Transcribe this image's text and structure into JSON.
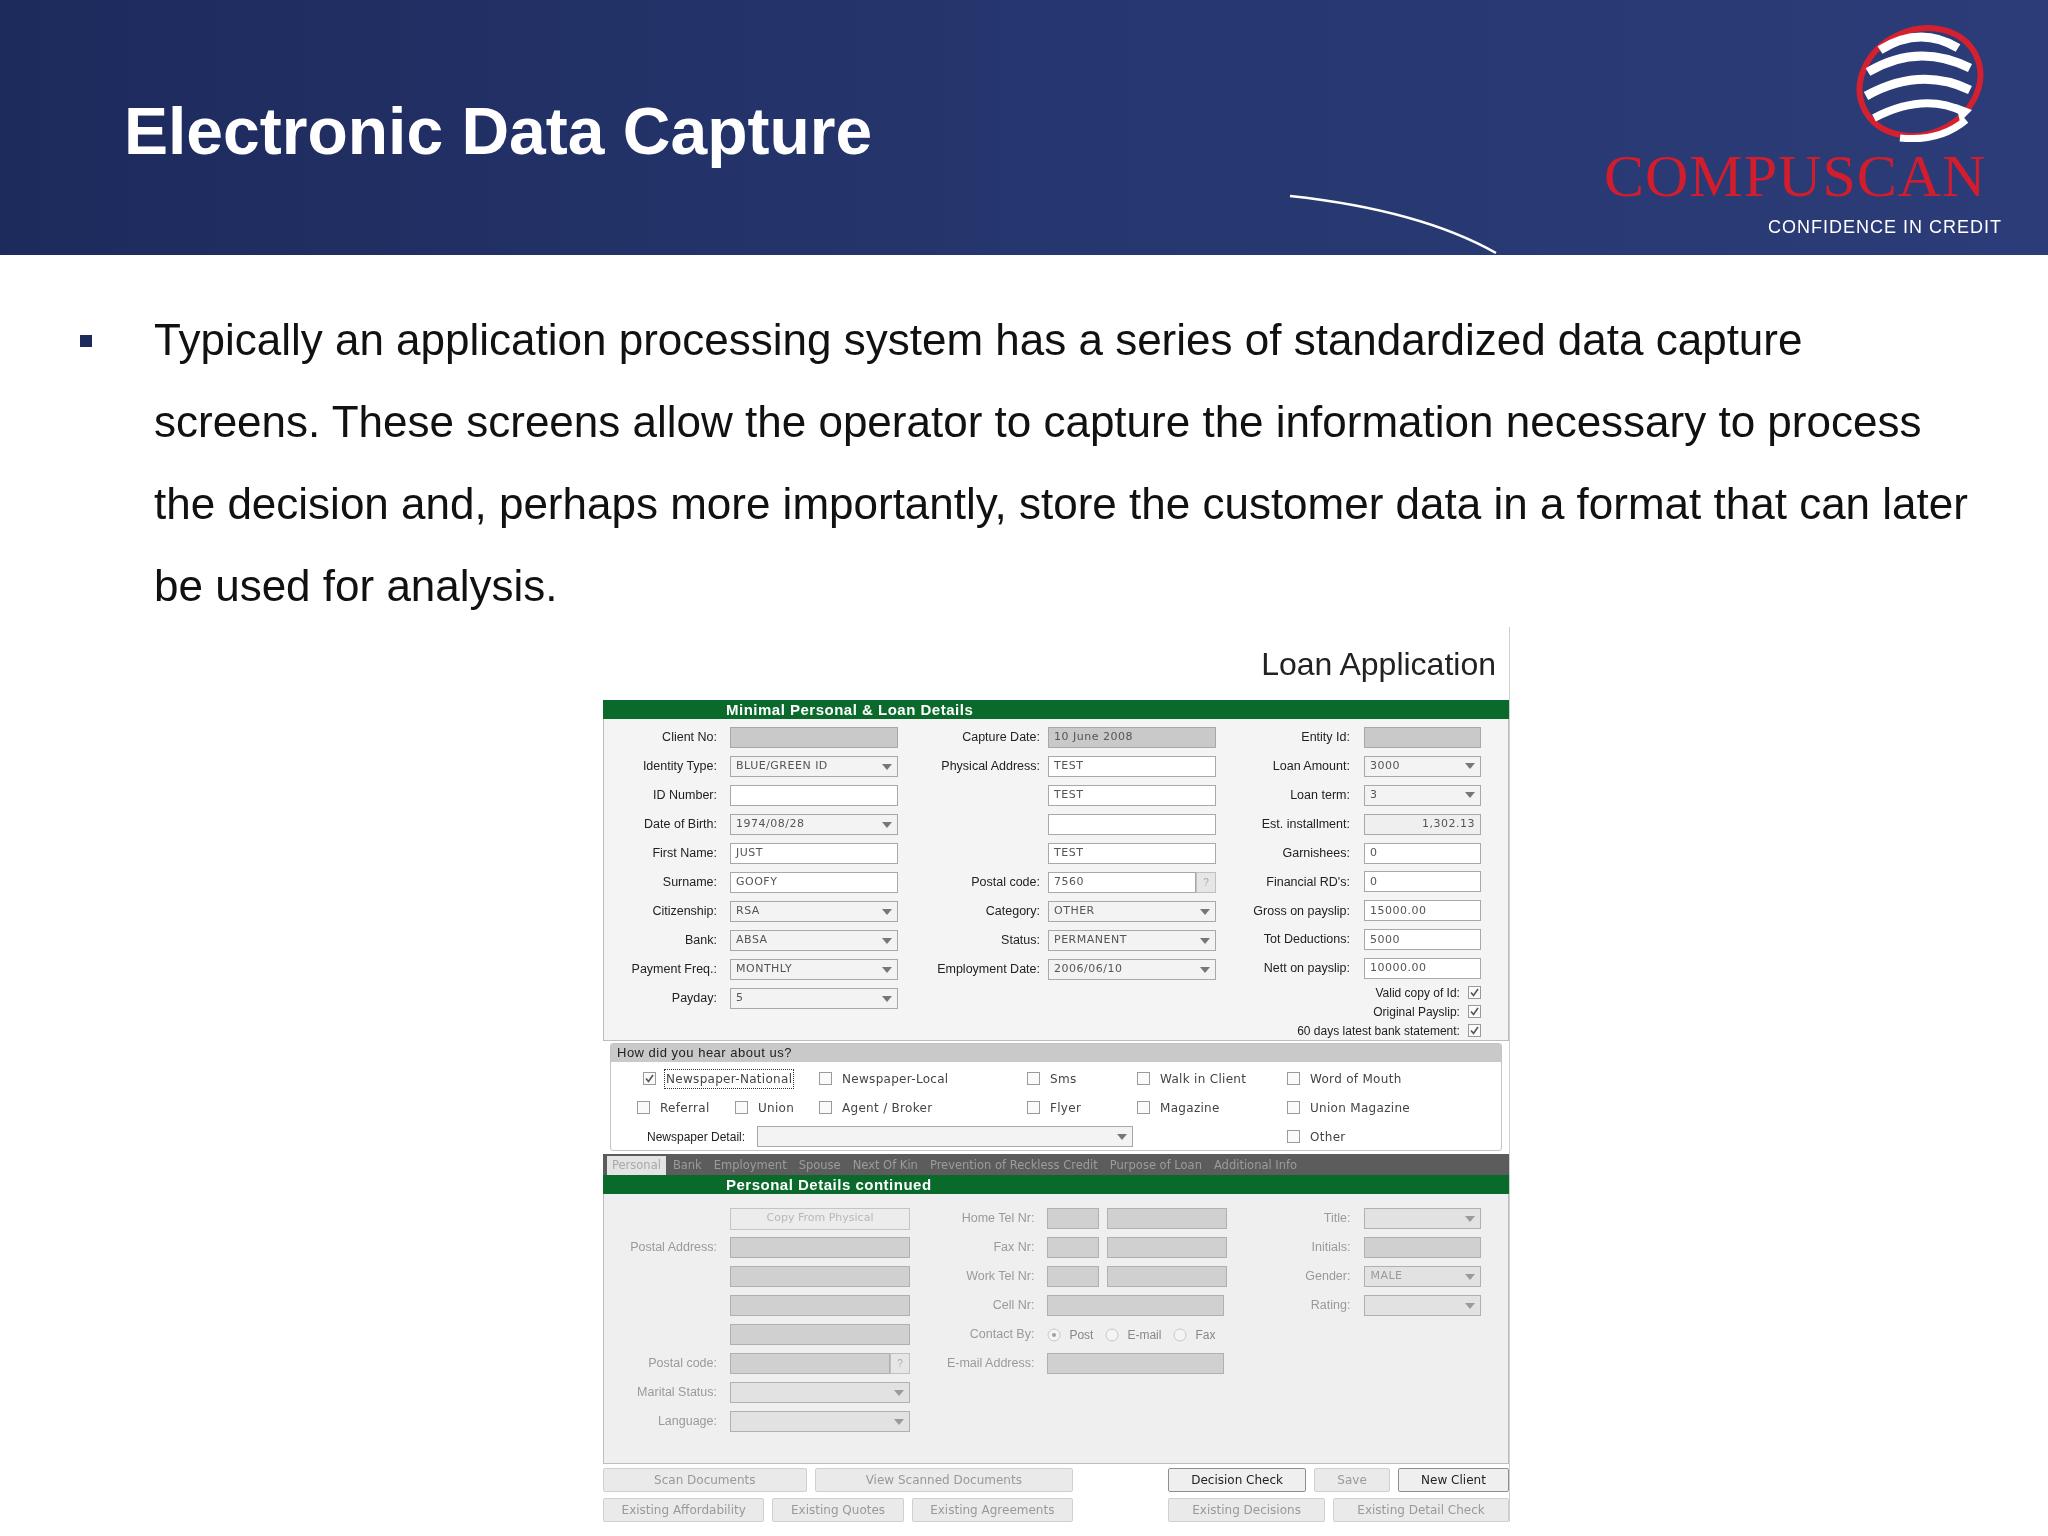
{
  "slide": {
    "title": "Electronic Data Capture",
    "logo": {
      "name": "COMPUSCAN",
      "tagline": "CONFIDENCE IN CREDIT"
    },
    "bullets": [
      "Typically an application processing system has a series of standardized data capture screens. These screens allow the operator to capture the information necessary to process the decision and, perhaps more importantly, store the customer data in a format that can later be used for analysis."
    ]
  },
  "form": {
    "title": "Loan Application",
    "main": {
      "heading": "Minimal Personal & Loan Details",
      "disabled": false,
      "columns": [
        [
          {
            "label": "Client No:",
            "kind": "readonly"
          },
          {
            "label": "Identity Type:",
            "kind": "select",
            "value": "BLUE/GREEN ID"
          },
          {
            "label": "ID Number:",
            "kind": "text"
          },
          {
            "label": "Date of Birth:",
            "kind": "select",
            "value": "1974/08/28"
          },
          {
            "label": "First Name:",
            "kind": "text",
            "value": "JUST"
          },
          {
            "label": "Surname:",
            "kind": "text",
            "value": "GOOFY"
          },
          {
            "label": "Citizenship:",
            "kind": "select",
            "value": "RSA"
          },
          {
            "label": "Bank:",
            "kind": "select",
            "value": "ABSA"
          },
          {
            "label": "Payment Freq.:",
            "kind": "select",
            "value": "MONTHLY"
          },
          {
            "label": "Payday:",
            "kind": "select",
            "value": "5"
          }
        ],
        [
          {
            "label": "Capture Date:",
            "kind": "readonly",
            "value": "10 June 2008"
          },
          {
            "label": "Physical Address:",
            "kind": "text",
            "value": "TEST"
          },
          {
            "kind": "text",
            "value": "TEST"
          },
          {
            "kind": "text"
          },
          {
            "kind": "text",
            "value": "TEST"
          },
          {
            "label": "Postal code:",
            "kind": "lookup",
            "value": "7560",
            "button": "?"
          },
          {
            "label": "Category:",
            "kind": "select",
            "value": "OTHER"
          },
          {
            "label": "Status:",
            "kind": "select",
            "value": "PERMANENT"
          },
          {
            "label": "Employment Date:",
            "kind": "select",
            "value": "2006/06/10"
          }
        ],
        [
          {
            "label": "Entity Id:",
            "kind": "readonly"
          },
          {
            "label": "Loan Amount:",
            "kind": "select",
            "value": "3000"
          },
          {
            "label": "Loan term:",
            "kind": "select",
            "value": "3"
          },
          {
            "label": "Est. installment:",
            "kind": "amount",
            "value": "1,302.13"
          },
          {
            "label": "Garnishees:",
            "kind": "text",
            "value": "0"
          },
          {
            "label": "Financial RD's:",
            "kind": "text",
            "value": "0"
          },
          {
            "label": "Gross on payslip:",
            "kind": "text",
            "value": "15000.00"
          },
          {
            "label": "Tot Deductions:",
            "kind": "text",
            "value": "5000"
          },
          {
            "label": "Nett on payslip:",
            "kind": "text",
            "value": "10000.00"
          }
        ]
      ],
      "checks": [
        {
          "label": "Valid copy of Id:",
          "checked": true
        },
        {
          "label": "Original Payslip:",
          "checked": true
        },
        {
          "label": "60 days latest bank statement:",
          "checked": true
        }
      ]
    },
    "hear": {
      "heading": "How did you hear about us?",
      "rows": [
        [
          {
            "label": "Newspaper-National",
            "checked": true,
            "focused": true
          },
          "",
          {
            "label": "Newspaper-Local",
            "checked": false,
            "focused": false
          },
          {
            "label": "Sms",
            "checked": false,
            "focused": false
          },
          {
            "label": "Walk in Client",
            "checked": false,
            "focused": false
          },
          {
            "label": "Word of Mouth",
            "checked": false,
            "focused": false
          }
        ],
        [
          {
            "label": "Referral",
            "checked": false,
            "focused": false
          },
          {
            "label": "Union",
            "checked": false,
            "focused": false
          },
          {
            "label": "Agent / Broker",
            "checked": false,
            "focused": false
          },
          {
            "label": "Flyer",
            "checked": false,
            "focused": false
          },
          {
            "label": "Magazine",
            "checked": false,
            "focused": false
          },
          {
            "label": "Union Magazine",
            "checked": false,
            "focused": false
          }
        ]
      ],
      "detail_label": "Newspaper Detail:",
      "other": {
        "label": "Other",
        "checked": false,
        "focused": false
      }
    },
    "tabs": [
      {
        "label": "Personal",
        "selected": true
      },
      {
        "label": "Bank",
        "selected": false
      },
      {
        "label": "Employment",
        "selected": false
      },
      {
        "label": "Spouse",
        "selected": false
      },
      {
        "label": "Next Of Kin",
        "selected": false
      },
      {
        "label": "Prevention of Reckless Credit",
        "selected": false
      },
      {
        "label": "Purpose of Loan",
        "selected": false
      },
      {
        "label": "Additional Info",
        "selected": false
      }
    ],
    "personal": {
      "heading": "Personal Details continued",
      "disabled": true,
      "columns": [
        [
          {
            "kind": "button",
            "value": "Copy From Physical"
          },
          {
            "label": "Postal Address:",
            "kind": "text"
          },
          {
            "kind": "text"
          },
          {
            "kind": "text"
          },
          {
            "kind": "text"
          },
          {
            "label": "Postal code:",
            "kind": "lookup",
            "button": "?"
          },
          {
            "label": "Marital Status:",
            "kind": "select"
          },
          {
            "label": "Language:",
            "kind": "select"
          }
        ],
        [
          {
            "label": "Home Tel Nr:",
            "kind": "phone"
          },
          {
            "label": "Fax Nr:",
            "kind": "phone"
          },
          {
            "label": "Work Tel Nr:",
            "kind": "phone"
          },
          {
            "label": "Cell Nr:",
            "kind": "text"
          },
          {
            "label": "Contact By:",
            "kind": "radios",
            "options": [
              {
                "label": "Post",
                "selected": true
              },
              {
                "label": "E-mail",
                "selected": false
              },
              {
                "label": "Fax",
                "selected": false
              }
            ]
          },
          {
            "label": "E-mail Address:",
            "kind": "wide"
          }
        ],
        [
          {
            "label": "Title:",
            "kind": "select"
          },
          {
            "label": "Initials:",
            "kind": "text"
          },
          {
            "label": "Gender:",
            "kind": "select",
            "value": "MALE"
          },
          {
            "label": "Rating:",
            "kind": "select"
          }
        ]
      ]
    },
    "buttons": [
      {
        "left": [
          {
            "label": "Scan Documents",
            "disabled": true
          },
          {
            "label": "View Scanned Documents",
            "disabled": true
          }
        ],
        "right": [
          {
            "label": "Decision Check",
            "disabled": false
          },
          {
            "label": "Save",
            "disabled": true
          },
          {
            "label": "New Client",
            "disabled": false
          }
        ]
      },
      {
        "left": [
          {
            "label": "Existing Affordability",
            "disabled": true
          },
          {
            "label": "Existing Quotes",
            "disabled": true
          },
          {
            "label": "Existing Agreements",
            "disabled": true
          }
        ],
        "right": [
          {
            "label": "Existing Decisions",
            "disabled": true
          },
          {
            "label": "Existing Detail Check",
            "disabled": true
          }
        ]
      }
    ]
  }
}
